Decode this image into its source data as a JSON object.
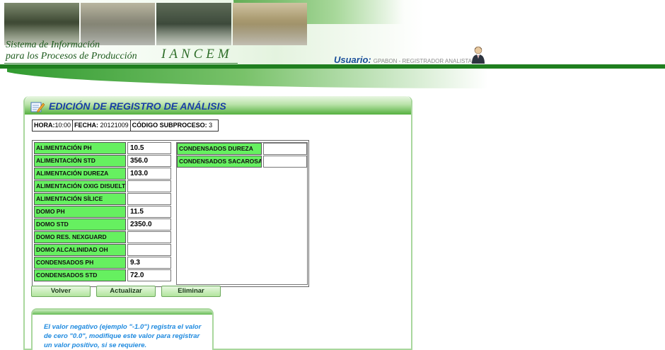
{
  "header": {
    "system_line1": "Sistema de Información",
    "system_line2": "para los Procesos de Producción",
    "brand": "IANCEM",
    "user_label": "Usuario:",
    "user_value": "GPABON - REGISTRADOR ANALISTAS"
  },
  "panel": {
    "title": "EDICIÓN DE REGISTRO DE ANÁLISIS",
    "meta": {
      "hora_label": "HORA:",
      "hora_value": "10:00",
      "fecha_label": "FECHA:",
      "fecha_value": "20121009",
      "subproceso_label": "CÓDIGO SUBPROCESO:",
      "subproceso_value": "3"
    },
    "left_fields": [
      {
        "label": "ALIMENTACIÓN PH",
        "value": "10.5"
      },
      {
        "label": "ALIMENTACIÓN STD",
        "value": "356.0"
      },
      {
        "label": "ALIMENTACIÓN DUREZA",
        "value": "103.0"
      },
      {
        "label": "ALIMENTACIÓN OXIG DISUELTO",
        "value": ""
      },
      {
        "label": "ALIMENTACIÓN SÍLICE",
        "value": ""
      },
      {
        "label": "DOMO PH",
        "value": "11.5"
      },
      {
        "label": "DOMO STD",
        "value": "2350.0"
      },
      {
        "label": "DOMO RES. NEXGUARD",
        "value": ""
      },
      {
        "label": "DOMO ALCALINIDAD OH",
        "value": ""
      },
      {
        "label": "CONDENSADOS PH",
        "value": "9.3"
      },
      {
        "label": "CONDENSADOS STD",
        "value": "72.0"
      }
    ],
    "right_fields": [
      {
        "label": "CONDENSADOS DUREZA",
        "value": ""
      },
      {
        "label": "CONDENSADOS SACAROSA",
        "value": ""
      }
    ],
    "buttons": {
      "back": "Volver",
      "update": "Actualizar",
      "delete": "Eliminar"
    },
    "note": "El valor negativo (ejemplo \"-1.0\") registra el valor de cero \"0.0\", modifique este valor para registrar un valor positivo, si se requiere."
  },
  "colors": {
    "field_label_bg": "#66f060",
    "title_blue": "#1a3fa6",
    "note_blue": "#1f8adf",
    "header_green": "#1f7f1f"
  },
  "icons": [
    "user-icon",
    "edit-document-icon"
  ]
}
